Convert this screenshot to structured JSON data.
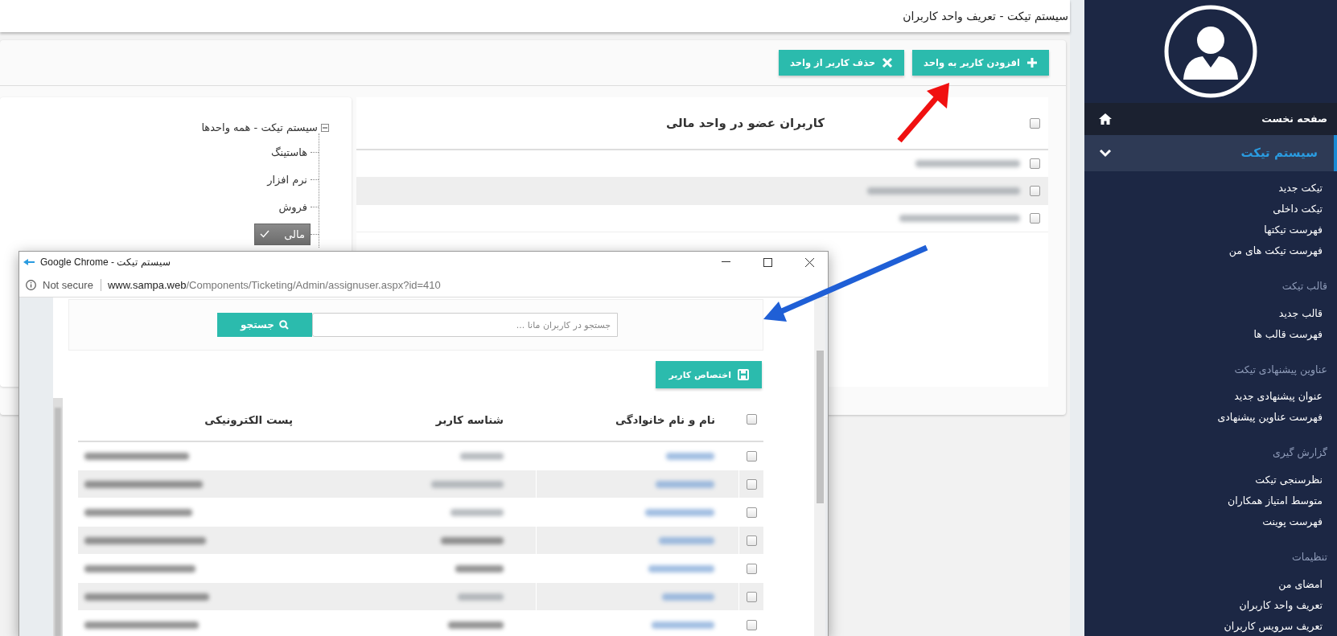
{
  "page_title": "سیستم تیکت - تعریف واحد کاربران",
  "toolbar": {
    "buttons": [
      {
        "label": "افزودن کاربر به واحد",
        "kind": "add"
      },
      {
        "label": "حذف کاربر از واحد",
        "kind": "remove"
      }
    ]
  },
  "members": {
    "title": "کاربران عضو در واحد مالی",
    "select_all_checked": false,
    "rows": [
      {
        "checked": false
      },
      {
        "checked": false
      },
      {
        "checked": false
      }
    ]
  },
  "tree": {
    "label": "سیستم تیکت - همه واحدها",
    "expanded": true,
    "children": [
      {
        "label": "هاستینگ",
        "selected": false
      },
      {
        "label": "نرم افزار",
        "selected": false
      },
      {
        "label": "فروش",
        "selected": false
      },
      {
        "label": "مالی",
        "selected": true
      }
    ]
  },
  "popup": {
    "title": "سیستم تیکت - Google Chrome",
    "security": "Not secure",
    "url_host": "www.sampa.web",
    "url_path": "/Components/Ticketing/Admin/assignuser.aspx?id=410",
    "search": {
      "placeholder": "جستجو در کاربران مانا ...",
      "button": "جستجو"
    },
    "assign_button": "اختصاص کاربر",
    "table": {
      "columns": [
        "نام و نام خانوادگی",
        "شناسه کاربر",
        "پست الکترونیکی"
      ],
      "select_all_checked": false,
      "rows": [
        {
          "checked": false
        },
        {
          "checked": false
        },
        {
          "checked": false
        },
        {
          "checked": false
        },
        {
          "checked": false
        },
        {
          "checked": false
        },
        {
          "checked": false
        }
      ]
    }
  },
  "sidebar": {
    "home": "صفحه نخست",
    "sections": [
      {
        "kind": "menu",
        "title": "سیستم تیکت",
        "expanded": true,
        "items": [
          "تیکت جدید",
          "تیکت داخلی",
          "فهرست تیکتها",
          "فهرست تیکت های من"
        ]
      },
      {
        "kind": "heading",
        "title": "قالب تیکت",
        "items": [
          "قالب جدید",
          "فهرست قالب ها"
        ]
      },
      {
        "kind": "heading",
        "title": "عناوین پیشنهادی تیکت",
        "items": [
          "عنوان پیشنهادی جدید",
          "فهرست عناوین پیشنهادی"
        ]
      },
      {
        "kind": "heading",
        "title": "گزارش گیری",
        "items": [
          "نظرسنجی تیکت",
          "متوسط امتیاز همکاران",
          "فهرست پوینت"
        ]
      },
      {
        "kind": "heading",
        "title": "تنظیمات",
        "items": [
          "امضای من",
          "تعریف واحد کاربران",
          "تعریف سرویس کاربران"
        ]
      }
    ]
  }
}
